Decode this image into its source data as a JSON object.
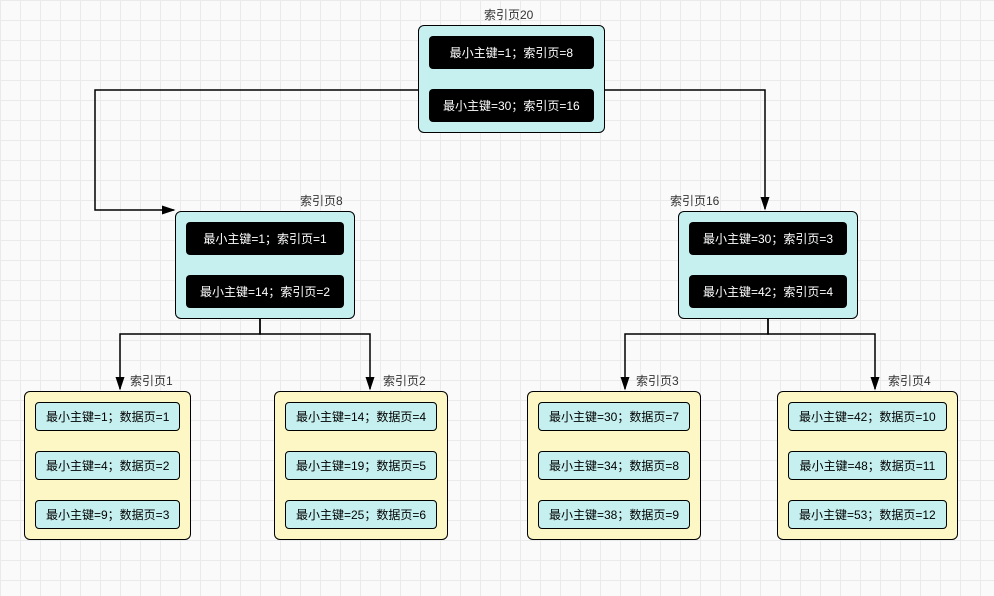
{
  "root": {
    "title": "索引页20",
    "entries": [
      "最小主键=1；索引页=8",
      "最小主键=30；索引页=16"
    ]
  },
  "mid_left": {
    "title": "索引页8",
    "entries": [
      "最小主键=1；索引页=1",
      "最小主键=14；索引页=2"
    ]
  },
  "mid_right": {
    "title": "索引页16",
    "entries": [
      "最小主键=30；索引页=3",
      "最小主键=42；索引页=4"
    ]
  },
  "leaf1": {
    "title": "索引页1",
    "entries": [
      "最小主键=1；数据页=1",
      "最小主键=4；数据页=2",
      "最小主键=9；数据页=3"
    ]
  },
  "leaf2": {
    "title": "索引页2",
    "entries": [
      "最小主键=14；数据页=4",
      "最小主键=19；数据页=5",
      "最小主键=25；数据页=6"
    ]
  },
  "leaf3": {
    "title": "索引页3",
    "entries": [
      "最小主键=30；数据页=7",
      "最小主键=34；数据页=8",
      "最小主键=38；数据页=9"
    ]
  },
  "leaf4": {
    "title": "索引页4",
    "entries": [
      "最小主键=42；数据页=10",
      "最小主键=48；数据页=11",
      "最小主键=53；数据页=12"
    ]
  }
}
